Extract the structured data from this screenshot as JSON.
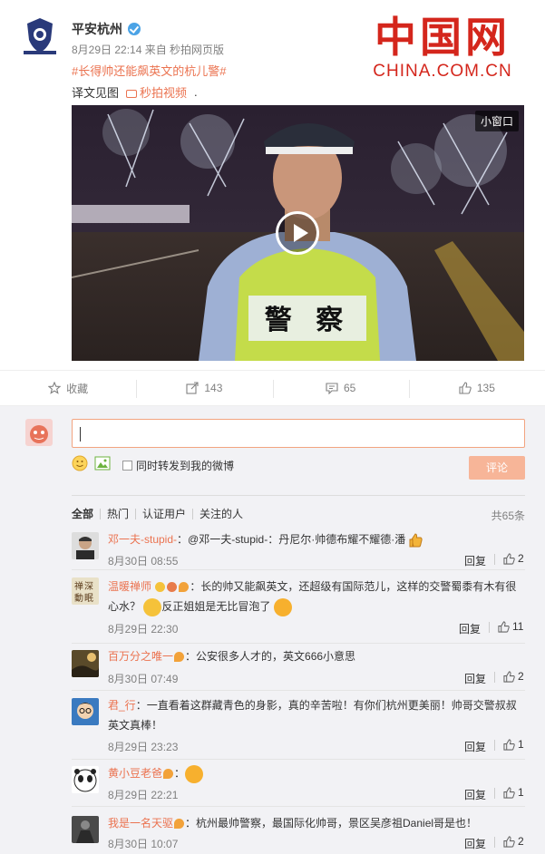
{
  "post": {
    "author": "平安杭州",
    "meta": "8月29日 22:14 来自 秒拍网页版",
    "hashtag": "#长得帅还能飙英文的杭儿警#",
    "translation_text": "译文见图",
    "video_link": "秒拍视频",
    "trail": "."
  },
  "watermark": {
    "cn": "中国网",
    "en": "CHINA.COM.CN"
  },
  "video": {
    "small_window_label": "小窗口",
    "vest_text": "警 察"
  },
  "actions": [
    {
      "label": "收藏",
      "icon": "star-icon"
    },
    {
      "label": "143",
      "icon": "share-icon"
    },
    {
      "label": "65",
      "icon": "comment-icon"
    },
    {
      "label": "135",
      "icon": "thumb-up-icon"
    }
  ],
  "comment_box": {
    "also_forward_label": "同时转发到我的微博",
    "submit_label": "评论"
  },
  "filters": [
    "全部",
    "热门",
    "认证用户",
    "关注的人"
  ],
  "total": "共65条",
  "reply_label": "回复",
  "comments": [
    {
      "name": "邓一夫-stupid-",
      "text": "：@邓一夫-stupid-：丹尼尔·帅德布耀不耀德·潘",
      "time": "8月30日 08:55",
      "likes": "2"
    },
    {
      "name": "温暖禅师",
      "text": "：长的帅又能飙英文，还超级有国际范儿，这样的交警蜀黍有木有很心水？",
      "text2": "反正姐姐是无比冒泡了",
      "time": "8月29日 22:30",
      "likes": "11"
    },
    {
      "name": "百万分之唯一",
      "text": "：公安很多人才的，英文666小意思",
      "time": "8月30日 07:49",
      "likes": "2"
    },
    {
      "name": "君_行",
      "text": "：一直看着这群藏青色的身影，真的辛苦啦！有你们杭州更美丽！帅哥交警叔叔英文真棒！",
      "time": "8月29日 23:23",
      "likes": "1"
    },
    {
      "name": "黄小豆老爸",
      "text": "：",
      "time": "8月29日 22:21",
      "likes": "1"
    },
    {
      "name": "我是一名天驱",
      "text": "：杭州最帅警察，最国际化帅哥，景区吴彦祖Daniel哥是也！",
      "time": "8月30日 10:07",
      "likes": "2"
    }
  ],
  "colors": {
    "accent": "#eb7350",
    "watermark": "#d4261c",
    "link": "#0f5fa8"
  }
}
